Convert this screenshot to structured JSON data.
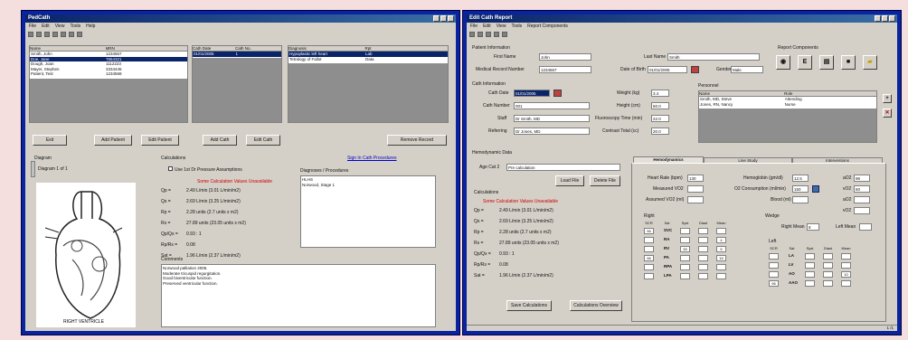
{
  "left_window": {
    "title": "PedCath",
    "menu": [
      "File",
      "Edit",
      "View",
      "Tools",
      "Help"
    ],
    "toolbar_icons": [
      "new-icon",
      "open-icon",
      "save-icon",
      "back-icon",
      "print-icon",
      "help-icon",
      "info-icon"
    ],
    "patients_list": {
      "columns": [
        "Name",
        "MRN"
      ],
      "rows": [
        [
          "Smith, John",
          "1234567"
        ],
        [
          "Doe, Jane",
          "7654321"
        ],
        [
          "Dough, Joan",
          "1112223"
        ],
        [
          "Mayer, Stephen",
          "3334445"
        ],
        [
          "Patient, Test",
          "1234568"
        ]
      ],
      "selected": 1
    },
    "caths_list": {
      "columns": [
        "Cath Date",
        "Cath No."
      ],
      "rows": [
        [
          "01/01/2005",
          "1"
        ]
      ],
      "selected": 0
    },
    "diagnoses_list": {
      "columns": [
        "Diagnosis",
        "Rpt"
      ],
      "rows": [
        [
          "Hypoplastic left heart",
          "Lab"
        ],
        [
          "Tetralogy of Fallot",
          "Data"
        ]
      ],
      "selected": 0
    },
    "buttons": {
      "exit": "Exit",
      "add_patient": "Add Patient",
      "edit_patient": "Edit Patient",
      "add_cath": "Add Cath",
      "edit_cath": "Edit Cath",
      "remove": "Remove Record"
    },
    "diagram": {
      "title": "Diagram",
      "diagram_label": "Diagram 1 of 1",
      "caption": "RIGHT VENTRICLE"
    },
    "calculations": {
      "title": "Calculations",
      "option": "Use 1st Dr Pressure Assumptions",
      "warning": "Some Calculation Values Unavailable",
      "fields": [
        [
          "Qp =",
          "2.49 L/min (3.01 L/min/m2)"
        ],
        [
          "Qs =",
          "2.69 L/min (3.25 L/min/m2)"
        ],
        [
          "Rp =",
          "2.28 units (2.7 units x m2)"
        ],
        [
          "Rs =",
          "27.89 units (23.05 units x m2)"
        ],
        [
          "Qp/Qs =",
          "0.93 : 1"
        ],
        [
          "Rp/Rs =",
          "0.08"
        ],
        [
          "Sat =",
          "1.96 L/min (2.37 L/min/m2)"
        ]
      ]
    },
    "diag_procedures": {
      "title": "Diagnoses / Procedures",
      "link": "Sign In Cath Procedures",
      "items": [
        "HLHS",
        "Norwood, Stage 1"
      ]
    },
    "comments": {
      "title": "Comments",
      "lines": [
        "Norwood palliation 2005.",
        "Moderate tricuspid regurgitation.",
        "Good biventricular function.",
        "Preserved ventricular function."
      ]
    }
  },
  "right_window": {
    "title": "Edit Cath Report",
    "menu": [
      "File",
      "Edit",
      "View",
      "Tools",
      "Report Components"
    ],
    "toolbar_icons": [
      "save-icon",
      "print-icon",
      "undo-icon",
      "close-icon",
      "help-icon"
    ],
    "patient_info": {
      "title": "Patient Information",
      "first_name_label": "First Name",
      "first_name": "John",
      "last_name_label": "Last Name",
      "last_name": "Smith",
      "mrn_label": "Medical Record Number",
      "mrn": "1234567",
      "dob_label": "Date of Birth",
      "dob": "01/01/2005",
      "gender_label": "Gender",
      "gender": "Male"
    },
    "report_components": {
      "title": "Report Components",
      "icons": [
        "disk-icon",
        "chart-icon",
        "document-icon",
        "camera-icon",
        "folder-icon"
      ]
    },
    "cath_info": {
      "title": "Cath Information",
      "cath_date_label": "Cath Date",
      "cath_date": "01/01/2005",
      "cath_number_label": "Cath Number",
      "cath_number": "001",
      "staff_label": "Staff",
      "staff": "Dr Smith, MD",
      "referring_label": "Referring",
      "referring": "Dr Jones, MD",
      "weight_label": "Weight (kg)",
      "weight": "3.4",
      "height_label": "Height (cm)",
      "height": "50.0",
      "fluoro_label": "Fluoroscopy Time (min)",
      "fluoro": "22.0",
      "contrast_label": "Contrast Total (cc)",
      "contrast": "20.0"
    },
    "personnel": {
      "title": "Personnel",
      "columns": [
        "Name",
        "Role"
      ],
      "rows": [
        [
          "Smith, MD, Steve",
          "Attending"
        ],
        [
          "Jones, RN, Nancy",
          "Nurse"
        ]
      ]
    },
    "hemo_file": {
      "title": "Hemodynamic Data",
      "age_label": "Age Cat 2",
      "age_value": "Pre calculation",
      "load_button": "Load File",
      "delete_button": "Delete File"
    },
    "calculations": {
      "title": "Calculations",
      "warning": "Some Calculation Values Unavailable",
      "fields": [
        [
          "Qp =",
          "2.49 L/min (3.01 L/min/m2)"
        ],
        [
          "Qs =",
          "2.69 L/min (3.25 L/min/m2)"
        ],
        [
          "Rp =",
          "2.28 units (2.7 units x m2)"
        ],
        [
          "Rs =",
          "27.89 units (23.05 units x m2)"
        ],
        [
          "Qp/Qs =",
          "0.93 : 1"
        ],
        [
          "Rp/Rs =",
          "0.08"
        ],
        [
          "Sat =",
          "1.96 L/min (2.37 L/min/m2)"
        ]
      ],
      "save_button": "Save Calculations",
      "inline_button": "Calculations Overview"
    },
    "tabs": [
      "Hemodynamics",
      "Line Study",
      "Interventions"
    ],
    "hemo": {
      "heart_rate_label": "Heart Rate (bpm)",
      "heart_rate": "130",
      "vo2_label": "Measured VO2",
      "vo2": "",
      "assumed_vo2_label": "Assumed VO2 (ml)",
      "assumed_vo2": "",
      "hemoglobin_label": "Hemoglobin (gm/dl)",
      "hemoglobin": "12.5",
      "o2_consumption_label": "O2 Consumption (ml/min)",
      "o2_consumption": "150",
      "blood_label": "Blood (ml)",
      "blood": "",
      "ao2_label": "aO2",
      "ao2": "96",
      "vo2b_label": "vO2",
      "vo2b": "60",
      "ao2b_label": "aO2",
      "ao2b": "",
      "vo2c_label": "vO2",
      "vo2c": ""
    },
    "right_grid": {
      "title": "Right",
      "columns": [
        "SCR",
        "Sat",
        "Syst",
        "Diast",
        "Mean"
      ],
      "rows": [
        [
          "96",
          "SVC",
          "",
          "",
          ""
        ],
        [
          "",
          "RA",
          "",
          "",
          "4"
        ],
        [
          "",
          "RV",
          "35",
          "",
          "5"
        ],
        [
          "96",
          "PA",
          "",
          "",
          "15"
        ],
        [
          "",
          "RPA",
          "",
          "",
          ""
        ],
        [
          "",
          "LPA",
          "",
          "",
          ""
        ]
      ]
    },
    "wedge": {
      "title": "Wedge",
      "right_label": "Right Mean",
      "right_value": "8",
      "left_label": "Left Mean",
      "left_value": ""
    },
    "left_grid": {
      "title": "Left",
      "columns": [
        "SCR",
        "Sat",
        "Syst",
        "Diast",
        "Mean"
      ],
      "rows": [
        [
          "",
          "LA",
          "",
          "",
          ""
        ],
        [
          "",
          "LV",
          "",
          "",
          ""
        ],
        [
          "",
          "AO",
          "",
          "",
          "10"
        ],
        [
          "96",
          "AAO",
          "",
          "",
          ""
        ]
      ]
    },
    "status": "1 /1"
  }
}
